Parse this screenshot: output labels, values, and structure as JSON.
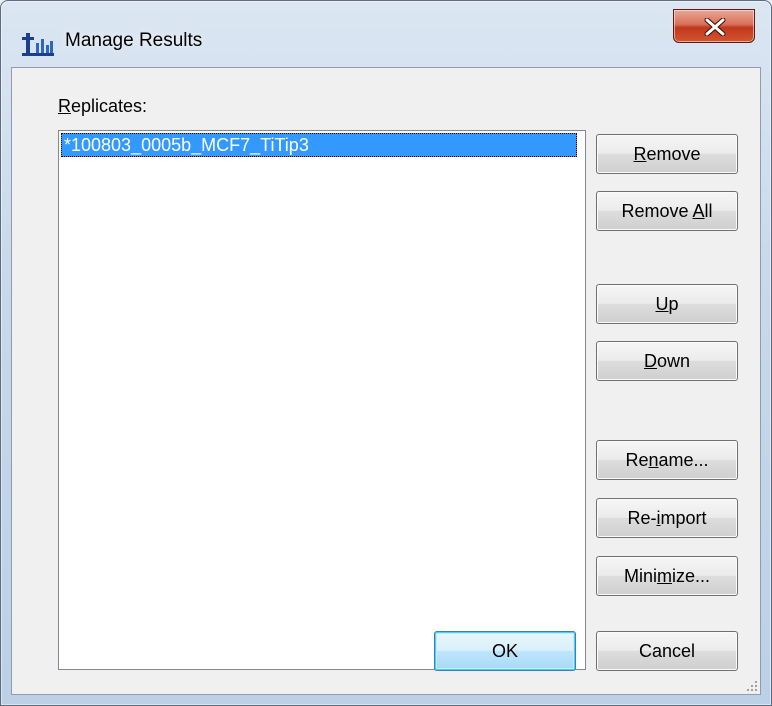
{
  "window": {
    "title": "Manage Results",
    "close_label": "X"
  },
  "replicates": {
    "label_pre": "",
    "label_mnemonic": "R",
    "label_post": "eplicates:",
    "items": [
      {
        "text": "*100803_0005b_MCF7_TiTip3",
        "selected": true
      }
    ]
  },
  "buttons": {
    "remove": {
      "pre": "",
      "key": "R",
      "post": "emove"
    },
    "remove_all": {
      "pre": "Remove ",
      "key": "A",
      "post": "ll"
    },
    "up": {
      "pre": "",
      "key": "U",
      "post": "p"
    },
    "down": {
      "pre": "",
      "key": "D",
      "post": "own"
    },
    "rename": {
      "pre": "Re",
      "key": "n",
      "post": "ame..."
    },
    "reimport": {
      "pre": "Re-",
      "key": "i",
      "post": "mport"
    },
    "minimize": {
      "pre": "Mini",
      "key": "m",
      "post": "ize..."
    },
    "ok": {
      "label": "OK"
    },
    "cancel": {
      "label": "Cancel"
    }
  },
  "colors": {
    "selection": "#3399ff",
    "close_button": "#c2371c"
  },
  "icons": {
    "app": "skyline-app-icon",
    "close": "close-icon",
    "grip": "resize-grip-icon"
  }
}
